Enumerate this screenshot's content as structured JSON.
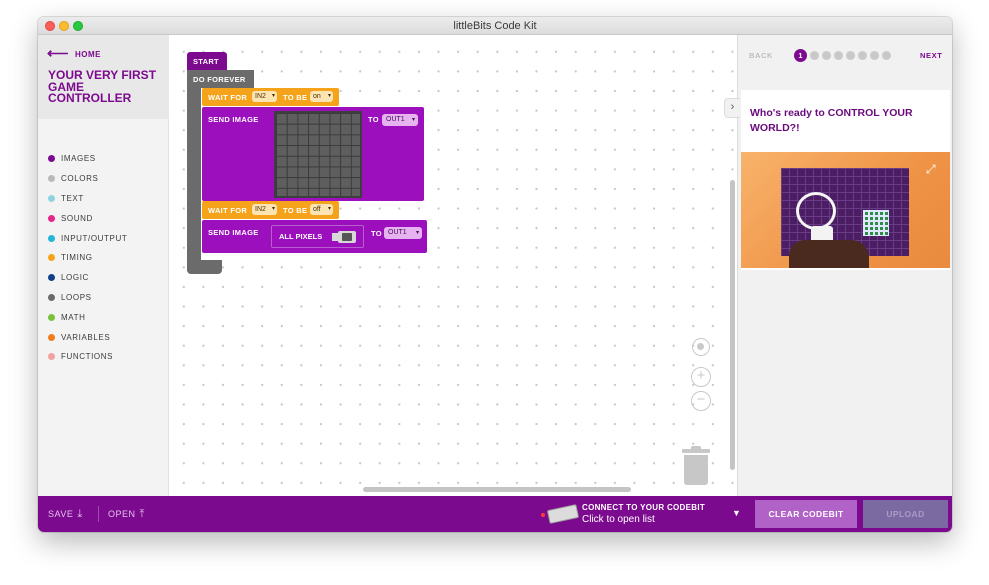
{
  "window": {
    "title": "littleBits Code Kit"
  },
  "sidebar": {
    "home_label": "HOME",
    "lesson_title": "YOUR VERY FIRST GAME CONTROLLER",
    "categories": [
      {
        "label": "IMAGES",
        "color": "#7c0a8e"
      },
      {
        "label": "COLORS",
        "color": "#b9b9b9"
      },
      {
        "label": "TEXT",
        "color": "#8ed3e0"
      },
      {
        "label": "SOUND",
        "color": "#e5268a"
      },
      {
        "label": "INPUT/OUTPUT",
        "color": "#22b6d8"
      },
      {
        "label": "TIMING",
        "color": "#f5a31a"
      },
      {
        "label": "LOGIC",
        "color": "#123f8c"
      },
      {
        "label": "LOOPS",
        "color": "#6b6b6b"
      },
      {
        "label": "MATH",
        "color": "#7ac23a"
      },
      {
        "label": "VARIABLES",
        "color": "#f07c1c"
      },
      {
        "label": "FUNCTIONS",
        "color": "#f2a0a0"
      }
    ]
  },
  "workspace": {
    "start": "START",
    "do_forever": "DO FOREVER",
    "wait1": {
      "label": "WAIT FOR",
      "input": "IN2",
      "to_be": "TO BE",
      "state": "on"
    },
    "send1": {
      "label": "SEND IMAGE",
      "to": "TO",
      "output": "OUT1"
    },
    "wait2": {
      "label": "WAIT FOR",
      "input": "IN2",
      "to_be": "TO BE",
      "state": "off"
    },
    "send2": {
      "label": "SEND IMAGE",
      "image": "ALL PIXELS",
      "to": "TO",
      "output": "OUT1"
    }
  },
  "instructions": {
    "back": "BACK",
    "current_step": "1",
    "total_steps": 8,
    "next": "NEXT",
    "text": "Who's ready to CONTROL YOUR WORLD?!"
  },
  "bottombar": {
    "save": "SAVE",
    "open": "OPEN",
    "connect_title": "CONNECT TO YOUR CODEBIT",
    "connect_sub": "Click to open list",
    "clear": "CLEAR CODEBIT",
    "upload": "UPLOAD"
  }
}
